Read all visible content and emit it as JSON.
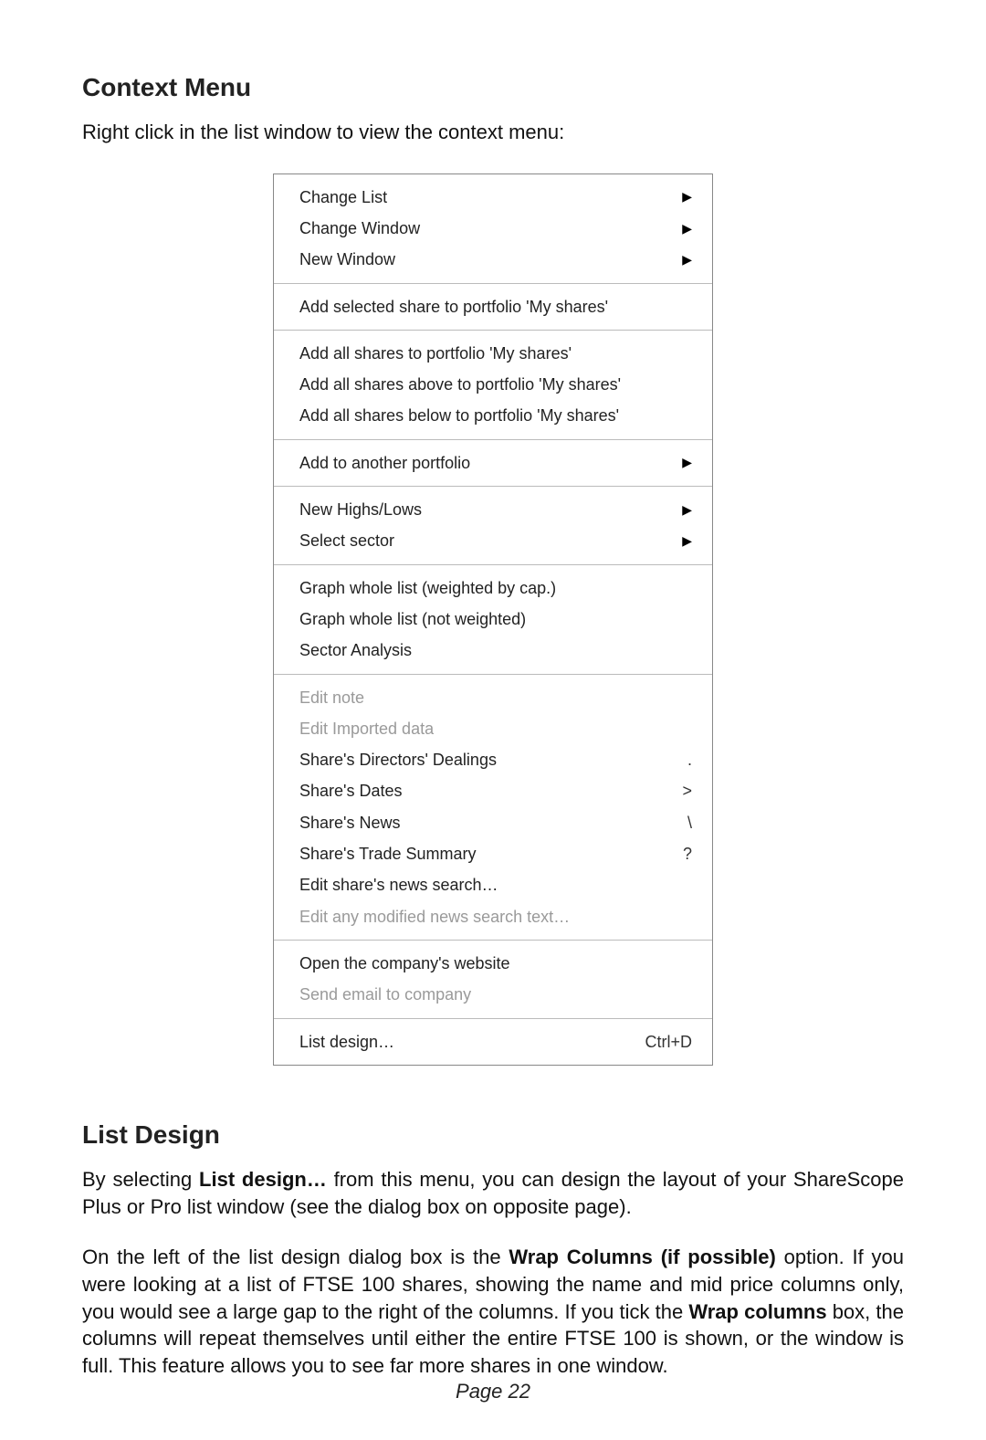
{
  "headings": {
    "context_menu": "Context Menu",
    "list_design": "List Design"
  },
  "intro": {
    "right_click_text": "Right click in the list window to view the context menu:"
  },
  "menu": {
    "groups": [
      {
        "items": [
          {
            "label": "Change List",
            "submenu": true,
            "disabled": false,
            "shortcut": ""
          },
          {
            "label": "Change Window",
            "submenu": true,
            "disabled": false,
            "shortcut": ""
          },
          {
            "label": "New Window",
            "submenu": true,
            "disabled": false,
            "shortcut": ""
          }
        ]
      },
      {
        "items": [
          {
            "label": "Add selected share to portfolio 'My shares'",
            "submenu": false,
            "disabled": false,
            "shortcut": ""
          }
        ]
      },
      {
        "items": [
          {
            "label": "Add all shares to portfolio 'My shares'",
            "submenu": false,
            "disabled": false,
            "shortcut": ""
          },
          {
            "label": "Add all shares above to portfolio 'My shares'",
            "submenu": false,
            "disabled": false,
            "shortcut": ""
          },
          {
            "label": "Add all shares below to portfolio 'My shares'",
            "submenu": false,
            "disabled": false,
            "shortcut": ""
          }
        ]
      },
      {
        "items": [
          {
            "label": "Add to another portfolio",
            "submenu": true,
            "disabled": false,
            "shortcut": ""
          }
        ]
      },
      {
        "items": [
          {
            "label": "New Highs/Lows",
            "submenu": true,
            "disabled": false,
            "shortcut": ""
          },
          {
            "label": "Select sector",
            "submenu": true,
            "disabled": false,
            "shortcut": ""
          }
        ]
      },
      {
        "items": [
          {
            "label": "Graph whole list (weighted by cap.)",
            "submenu": false,
            "disabled": false,
            "shortcut": ""
          },
          {
            "label": "Graph whole list (not weighted)",
            "submenu": false,
            "disabled": false,
            "shortcut": ""
          },
          {
            "label": "Sector Analysis",
            "submenu": false,
            "disabled": false,
            "shortcut": ""
          }
        ]
      },
      {
        "items": [
          {
            "label": "Edit note",
            "submenu": false,
            "disabled": true,
            "shortcut": ""
          },
          {
            "label": "Edit Imported data",
            "submenu": false,
            "disabled": true,
            "shortcut": ""
          },
          {
            "label": "Share's Directors' Dealings",
            "submenu": false,
            "disabled": false,
            "shortcut": "."
          },
          {
            "label": "Share's Dates",
            "submenu": false,
            "disabled": false,
            "shortcut": ">"
          },
          {
            "label": "Share's News",
            "submenu": false,
            "disabled": false,
            "shortcut": "\\"
          },
          {
            "label": "Share's Trade Summary",
            "submenu": false,
            "disabled": false,
            "shortcut": "?"
          },
          {
            "label": "Edit share's news search…",
            "submenu": false,
            "disabled": false,
            "shortcut": ""
          },
          {
            "label": "Edit any modified news search text…",
            "submenu": false,
            "disabled": true,
            "shortcut": ""
          }
        ]
      },
      {
        "items": [
          {
            "label": "Open the company's website",
            "submenu": false,
            "disabled": false,
            "shortcut": ""
          },
          {
            "label": "Send email to company",
            "submenu": false,
            "disabled": true,
            "shortcut": ""
          }
        ]
      },
      {
        "items": [
          {
            "label": "List design…",
            "submenu": false,
            "disabled": false,
            "shortcut": "Ctrl+D"
          }
        ]
      }
    ]
  },
  "list_design_section": {
    "p1_pre": "By selecting ",
    "p1_bold": "List design…",
    "p1_post": "  from this menu, you can design the layout of your ShareScope Plus or Pro list window (see the dialog box on opposite page).",
    "p2_pre": "On the left of the list design dialog box is the ",
    "p2_bold1": "Wrap Columns (if possible)",
    "p2_mid": " option. If you were looking at a list of FTSE 100 shares, showing the name and mid price columns only, you would see a large gap to the right of the columns.  If you tick the ",
    "p2_bold2": "Wrap columns",
    "p2_post": " box, the columns will repeat themselves until either the entire FTSE 100 is shown, or the window is full.  This feature allows you to see far more shares in one window."
  },
  "footer": {
    "page_label": "Page 22"
  },
  "icons": {
    "submenu_arrow": "▶"
  }
}
